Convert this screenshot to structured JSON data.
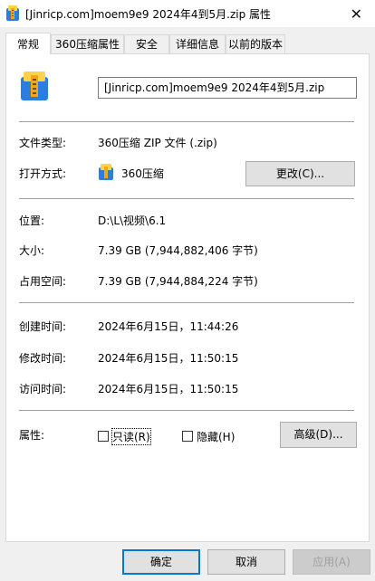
{
  "window": {
    "title": "[Jinricp.com]moem9e9 2024年4到5月.zip 属性",
    "close_glyph": "✕"
  },
  "tabs": [
    {
      "label": "常规",
      "active": true
    },
    {
      "label": "360压缩属性",
      "active": false
    },
    {
      "label": "安全",
      "active": false
    },
    {
      "label": "详细信息",
      "active": false
    },
    {
      "label": "以前的版本",
      "active": false
    }
  ],
  "general": {
    "file_name": "[Jinricp.com]moem9e9 2024年4到5月.zip",
    "file_type_label": "文件类型:",
    "file_type_value": "360压缩 ZIP 文件 (.zip)",
    "opens_with_label": "打开方式:",
    "opens_with_value": "360压缩",
    "change_button": "更改(C)...",
    "location_label": "位置:",
    "location_value": "D:\\L\\视频\\6.1",
    "size_label": "大小:",
    "size_value": "7.39 GB (7,944,882,406 字节)",
    "size_on_disk_label": "占用空间:",
    "size_on_disk_value": "7.39 GB (7,944,884,224 字节)",
    "created_label": "创建时间:",
    "created_value": "2024年6月15日，11:44:26",
    "modified_label": "修改时间:",
    "modified_value": "2024年6月15日，11:50:15",
    "accessed_label": "访问时间:",
    "accessed_value": "2024年6月15日，11:50:15",
    "attributes_label": "属性:",
    "readonly_label": "只读(R)",
    "hidden_label": "隐藏(H)",
    "advanced_button": "高级(D)..."
  },
  "footer": {
    "ok_button": "确定",
    "cancel_button": "取消",
    "apply_button": "应用(A)"
  },
  "colors": {
    "archive_blue": "#2a7de1",
    "archive_orange": "#f2a71b",
    "archive_yellow": "#ffd24a"
  }
}
